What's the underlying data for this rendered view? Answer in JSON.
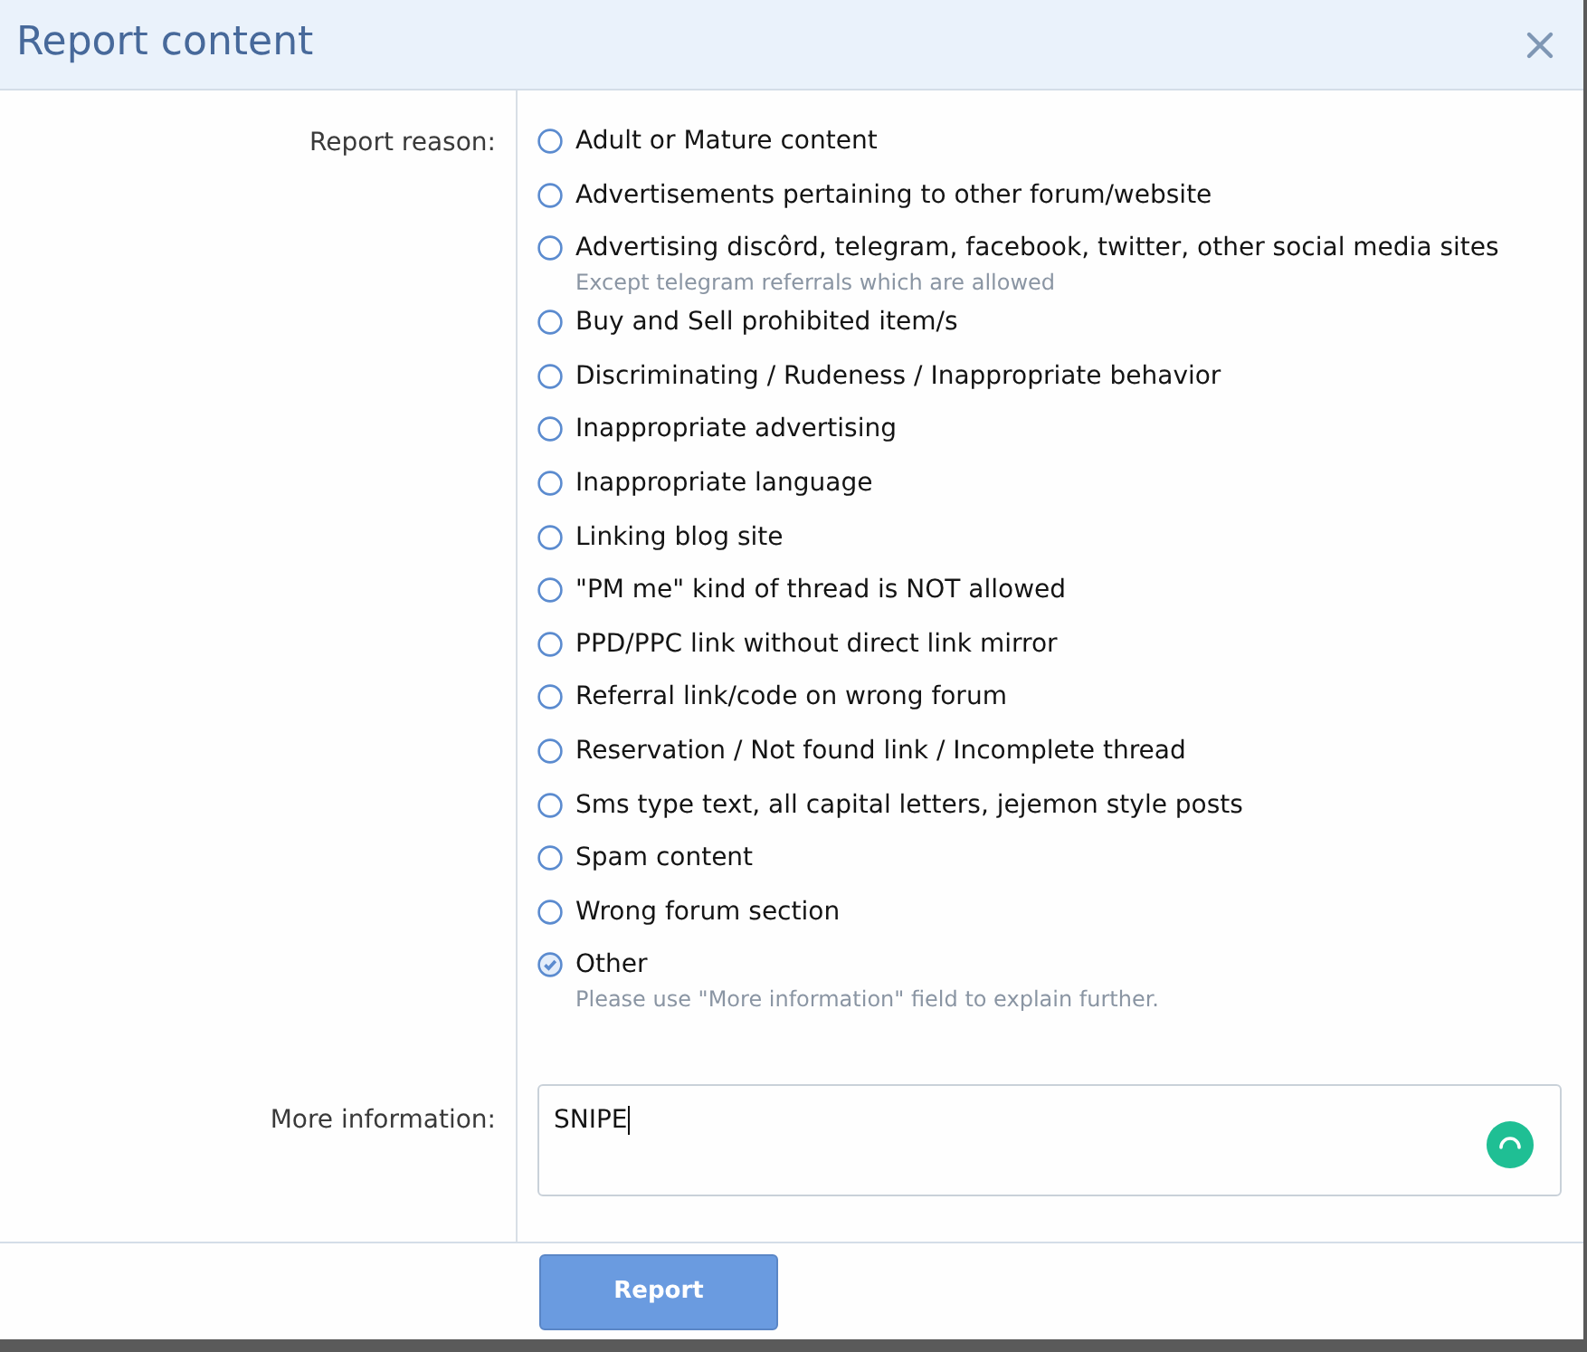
{
  "window": {
    "title": "Report content"
  },
  "reason": {
    "label": "Report reason:",
    "options": [
      {
        "label": "Adult or Mature content",
        "selected": false
      },
      {
        "label": "Advertisements pertaining to other forum/website",
        "selected": false
      },
      {
        "label": "Advertising discôrd, telegram, facebook, twitter, other social media sites",
        "hint": "Except telegram referrals which are allowed",
        "selected": false
      },
      {
        "label": "Buy and Sell prohibited item/s",
        "selected": false
      },
      {
        "label": "Discriminating / Rudeness / Inappropriate behavior",
        "selected": false
      },
      {
        "label": "Inappropriate advertising",
        "selected": false
      },
      {
        "label": "Inappropriate language",
        "selected": false
      },
      {
        "label": "Linking blog site",
        "selected": false
      },
      {
        "label": "\"PM me\" kind of thread is NOT allowed",
        "selected": false
      },
      {
        "label": "PPD/PPC link without direct link mirror",
        "selected": false
      },
      {
        "label": "Referral link/code on wrong forum",
        "selected": false
      },
      {
        "label": "Reservation / Not found link / Incomplete thread",
        "selected": false
      },
      {
        "label": "Sms type text, all capital letters, jejemon style posts",
        "selected": false
      },
      {
        "label": "Spam content",
        "selected": false
      },
      {
        "label": "Wrong forum section",
        "selected": false
      },
      {
        "label": "Other",
        "hint": "Please use \"More information\" field to explain further.",
        "selected": true
      }
    ]
  },
  "more_information": {
    "label": "More information:",
    "value": "SNIPE"
  },
  "buttons": [
    "Report"
  ]
}
